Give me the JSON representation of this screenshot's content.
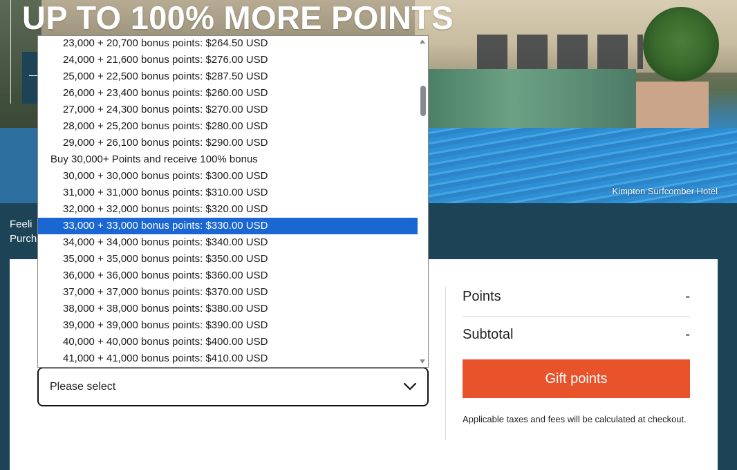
{
  "hero": {
    "title": "UP TO 100% MORE POINTS",
    "photo_credit": "Kimpton Surfcomber Hotel"
  },
  "band": {
    "line1": "Feeli",
    "line2": "Purch"
  },
  "select": {
    "value": "Please select",
    "icon": "chevron-down-icon"
  },
  "summary": {
    "points_label": "Points",
    "points_value": "-",
    "subtotal_label": "Subtotal",
    "subtotal_value": "-",
    "button_label": "Gift points",
    "taxes_note": "Applicable taxes and fees will be calculated at checkout."
  },
  "dropdown": {
    "scroll_position": 0.18,
    "options": [
      {
        "label": "23,000 + 20,700 bonus points: $264.50 USD",
        "type": "option"
      },
      {
        "label": "24,000 + 21,600 bonus points: $276.00 USD",
        "type": "option"
      },
      {
        "label": "25,000 + 22,500 bonus points: $287.50 USD",
        "type": "option"
      },
      {
        "label": "26,000 + 23,400 bonus points: $260.00 USD",
        "type": "option"
      },
      {
        "label": "27,000 + 24,300 bonus points: $270.00 USD",
        "type": "option"
      },
      {
        "label": "28,000 + 25,200 bonus points: $280.00 USD",
        "type": "option"
      },
      {
        "label": "29,000 + 26,100 bonus points: $290.00 USD",
        "type": "option"
      },
      {
        "label": "Buy 30,000+ Points and receive 100% bonus",
        "type": "group"
      },
      {
        "label": "30,000 + 30,000 bonus points: $300.00 USD",
        "type": "option"
      },
      {
        "label": "31,000 + 31,000 bonus points: $310.00 USD",
        "type": "option"
      },
      {
        "label": "32,000 + 32,000 bonus points: $320.00 USD",
        "type": "option"
      },
      {
        "label": "33,000 + 33,000 bonus points: $330.00 USD",
        "type": "option",
        "selected": true
      },
      {
        "label": "34,000 + 34,000 bonus points: $340.00 USD",
        "type": "option"
      },
      {
        "label": "35,000 + 35,000 bonus points: $350.00 USD",
        "type": "option"
      },
      {
        "label": "36,000 + 36,000 bonus points: $360.00 USD",
        "type": "option"
      },
      {
        "label": "37,000 + 37,000 bonus points: $370.00 USD",
        "type": "option"
      },
      {
        "label": "38,000 + 38,000 bonus points: $380.00 USD",
        "type": "option"
      },
      {
        "label": "39,000 + 39,000 bonus points: $390.00 USD",
        "type": "option"
      },
      {
        "label": "40,000 + 40,000 bonus points: $400.00 USD",
        "type": "option"
      },
      {
        "label": "41,000 + 41,000 bonus points: $410.00 USD",
        "type": "option"
      }
    ]
  },
  "colors": {
    "band": "#1d4456",
    "button": "#e8532c",
    "selected_option": "#1a66d2"
  }
}
